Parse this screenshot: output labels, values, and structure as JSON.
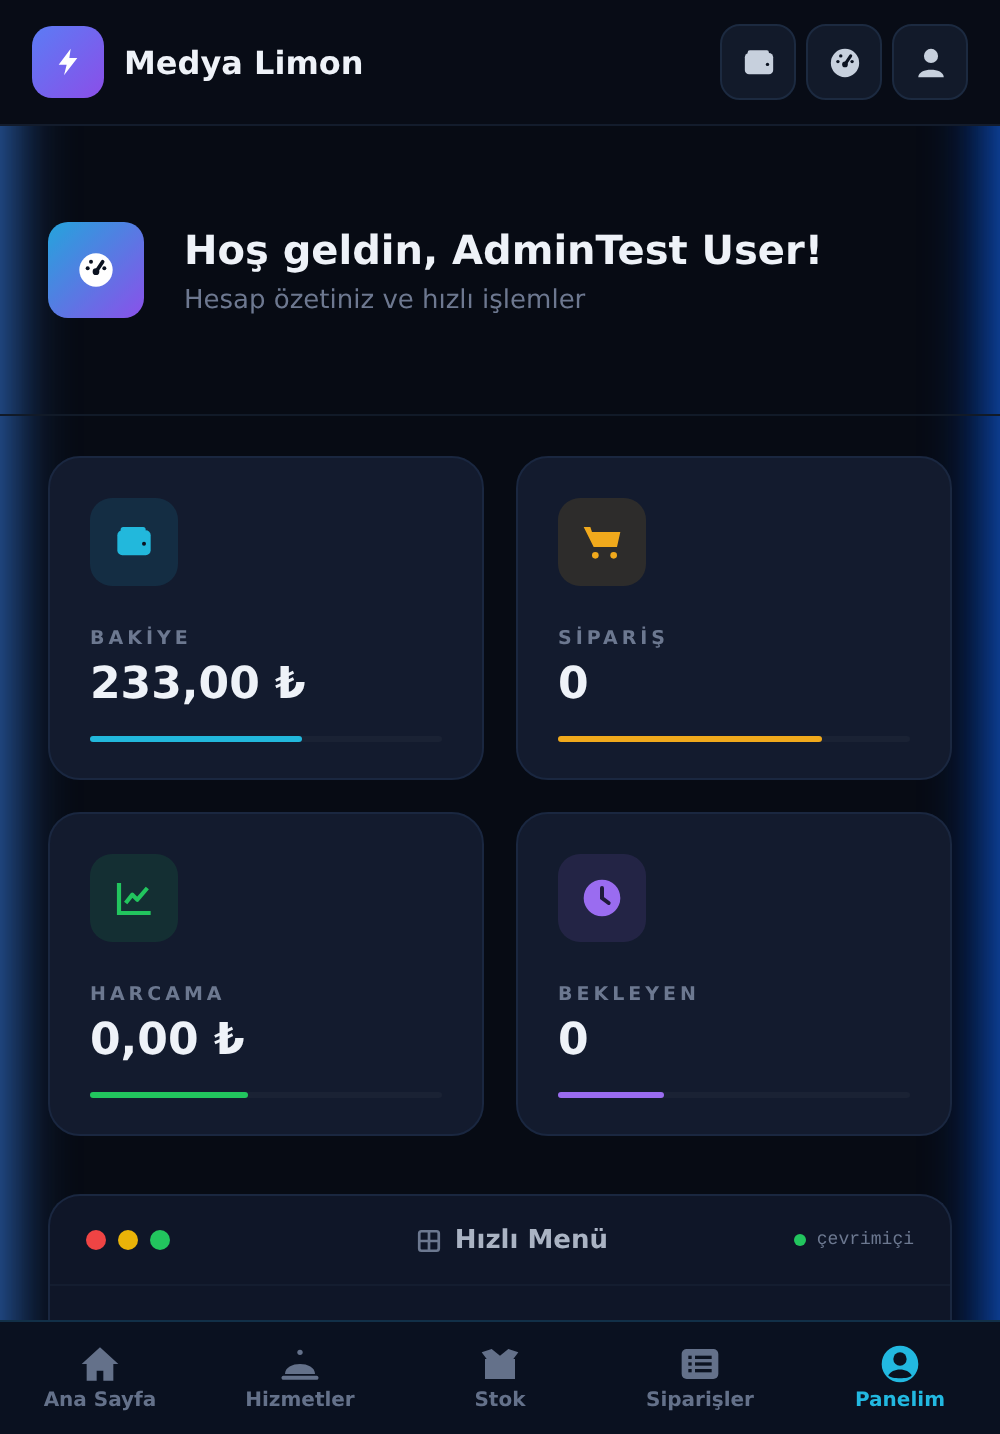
{
  "header": {
    "brand": "Medya Limon",
    "actions": [
      {
        "kind": "wallet"
      },
      {
        "kind": "gauge"
      },
      {
        "kind": "user"
      }
    ]
  },
  "welcome": {
    "title": "Hoş geldin, AdminTest User!",
    "subtitle": "Hesap özetiniz ve hızlı işlemler"
  },
  "stats": [
    {
      "kind": "wallet",
      "label": "BAKİYE",
      "value": "233,00 ₺",
      "level": 0.6,
      "color": "#22b8dc"
    },
    {
      "kind": "cart",
      "label": "SİPARİŞ",
      "value": "0",
      "level": 0.75,
      "color": "#f0a91c"
    },
    {
      "kind": "chart",
      "label": "HARCAMA",
      "value": "0,00 ₺",
      "level": 0.45,
      "color": "#22c55e"
    },
    {
      "kind": "clock",
      "label": "BEKLEYEN",
      "value": "0",
      "level": 0.3,
      "color": "#9a6cf0"
    }
  ],
  "quick_menu": {
    "dots": [
      {
        "color": "#ef4444"
      },
      {
        "color": "#eab308"
      },
      {
        "color": "#22c55e"
      }
    ],
    "title": "Hızlı Menü",
    "status": "çevrimiçi"
  },
  "nav": [
    {
      "kind": "home",
      "label": "Ana Sayfa",
      "selected": false
    },
    {
      "kind": "bell",
      "label": "Hizmetler",
      "selected": false
    },
    {
      "kind": "box",
      "label": "Stok",
      "selected": false
    },
    {
      "kind": "list",
      "label": "Siparişler",
      "selected": false
    },
    {
      "kind": "user",
      "label": "Panelim",
      "selected": true
    }
  ]
}
